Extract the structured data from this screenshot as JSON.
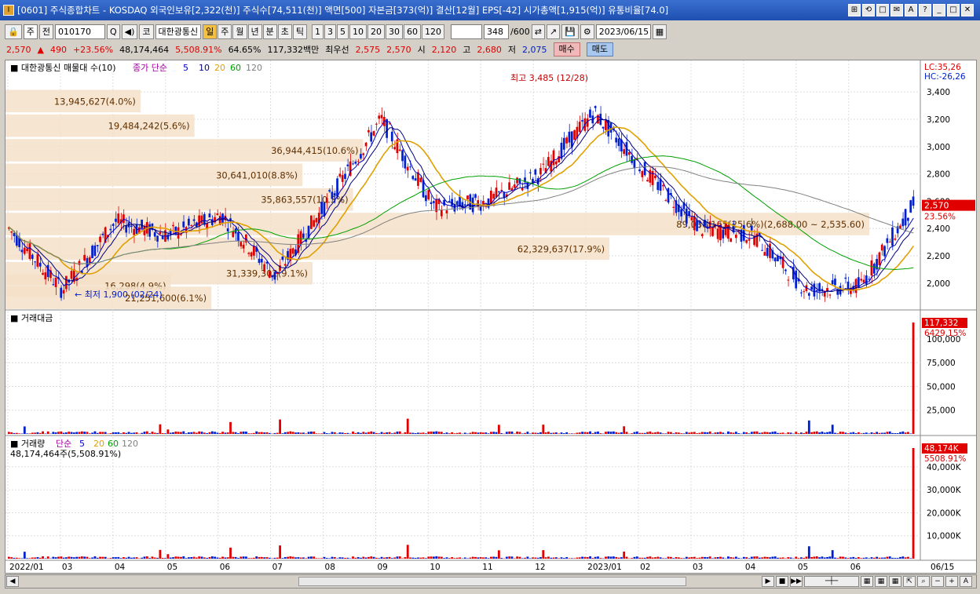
{
  "window": {
    "title": "[0601] 주식종합차트 - KOSDAQ 외국인보유[2,322(천)] 주식수[74,511(천)] 액면[500] 자본금[373(억)] 결산[12월] EPS[-42] 시가총액[1,915(억)] 유통비율[74.0]",
    "icon": "I"
  },
  "titlebar_buttons": [
    "⊞",
    "⟲",
    "□",
    "✉",
    "A",
    "?",
    "_",
    "□",
    "✕"
  ],
  "toolbar": {
    "market_select": "주",
    "prev_label": "전",
    "code": "010170",
    "stock_name": "대한광통신",
    "market_badge": "코",
    "periods": [
      "일",
      "주",
      "월",
      "년",
      "분",
      "초",
      "틱"
    ],
    "active_period": "일",
    "intervals": [
      "1",
      "3",
      "5",
      "10",
      "20",
      "30",
      "60",
      "120"
    ],
    "count": "348",
    "count_total": "/600",
    "date": "2023/06/15"
  },
  "pricebar": {
    "price": "2,570",
    "arrow": "▲",
    "change": "490",
    "change_pct": "+23.56%",
    "volume": "48,174,464",
    "vol_pct": "5,508.91%",
    "rate": "64.65%",
    "amount": "117,332백만",
    "bid_label": "최우선",
    "bid1": "2,575",
    "bid2": "2,570",
    "open_label": "시",
    "open": "2,120",
    "high_label": "고",
    "high": "2,680",
    "low_label": "저",
    "low": "2,075",
    "buy_label": "매수",
    "sell_label": "매도"
  },
  "main_panel": {
    "title": "대한광통신 매물대 수(10)",
    "ma_label": "종가 단순",
    "ma_periods": [
      "5",
      "10",
      "20",
      "60",
      "120"
    ],
    "ma_colors": [
      "#0000c0",
      "#000080",
      "#e0a000",
      "#00a000",
      "#808080"
    ],
    "lc": "LC:35,26",
    "hc": "HC:-26,26",
    "y_ticks": [
      "3,400",
      "3,200",
      "3,000",
      "2,800",
      "2,600",
      "2,400",
      "2,200",
      "2,000"
    ],
    "current_price": "2,570",
    "current_pct": "23.56%",
    "high_annot": "최고 3,485 (12/28)",
    "low_annot": "최저 1,900 (02/24)",
    "mid_annot": "HC:-26,26"
  },
  "volume_profile": [
    {
      "label": "13,945,627(4.0%)",
      "price": 3330,
      "pct": 4.0
    },
    {
      "label": "19,484,242(5.6%)",
      "price": 3150,
      "pct": 5.6
    },
    {
      "label": "36,944,415(10.6%)",
      "price": 2970,
      "pct": 10.6
    },
    {
      "label": "30,641,010(8.8%)",
      "price": 2790,
      "pct": 8.8
    },
    {
      "label": "35,863,557(10.3%)",
      "price": 2610,
      "pct": 10.3
    },
    {
      "label": "89,038,165(25.6%)(2,688.00 ~ 2,535.60)",
      "price": 2430,
      "pct": 25.6
    },
    {
      "label": "62,329,637(17.9%)",
      "price": 2250,
      "pct": 17.9
    },
    {
      "label": "31,339,302(9.1%)",
      "price": 2070,
      "pct": 9.1
    },
    {
      "label": "16,298(4.9%)",
      "price": 1980,
      "pct": 4.9
    },
    {
      "label": "21,251,600(6.1%)",
      "price": 1890,
      "pct": 6.1
    }
  ],
  "amount_panel": {
    "title": "거래대금",
    "y_ticks": [
      "100,000",
      "75,000",
      "50,000",
      "25,000"
    ],
    "last": "117,332",
    "last_pct": "6429.15%"
  },
  "volume_panel": {
    "title": "거래량",
    "ma_label": "단순",
    "ma_periods": [
      "5",
      "20",
      "60",
      "120"
    ],
    "info": "48,174,464주(5,508.91%)",
    "y_ticks": [
      "40,000K",
      "30,000K",
      "20,000K",
      "10,000K"
    ],
    "last": "48,174K",
    "last_pct": "5508.91%"
  },
  "x_axis": [
    "2022/01",
    "03",
    "04",
    "05",
    "06",
    "07",
    "08",
    "09",
    "10",
    "11",
    "12",
    "2023/01",
    "02",
    "03",
    "04",
    "05",
    "06",
    "06/15"
  ],
  "chart_data": {
    "type": "line",
    "title": "대한광통신 매물대 수(10)",
    "x": [
      "2022/01",
      "03",
      "04",
      "05",
      "06",
      "07",
      "08",
      "09",
      "10",
      "11",
      "12",
      "2023/01",
      "02",
      "03",
      "04",
      "05",
      "06",
      "06/15"
    ],
    "series": [
      {
        "name": "종가",
        "values": [
          2400,
          1950,
          2450,
          2350,
          2500,
          2050,
          2600,
          3200,
          2550,
          2600,
          2800,
          3250,
          2800,
          2400,
          2350,
          1950,
          1980,
          2570
        ]
      }
    ],
    "ylim": [
      1850,
      3550
    ],
    "high": 3485,
    "low": 1900
  }
}
